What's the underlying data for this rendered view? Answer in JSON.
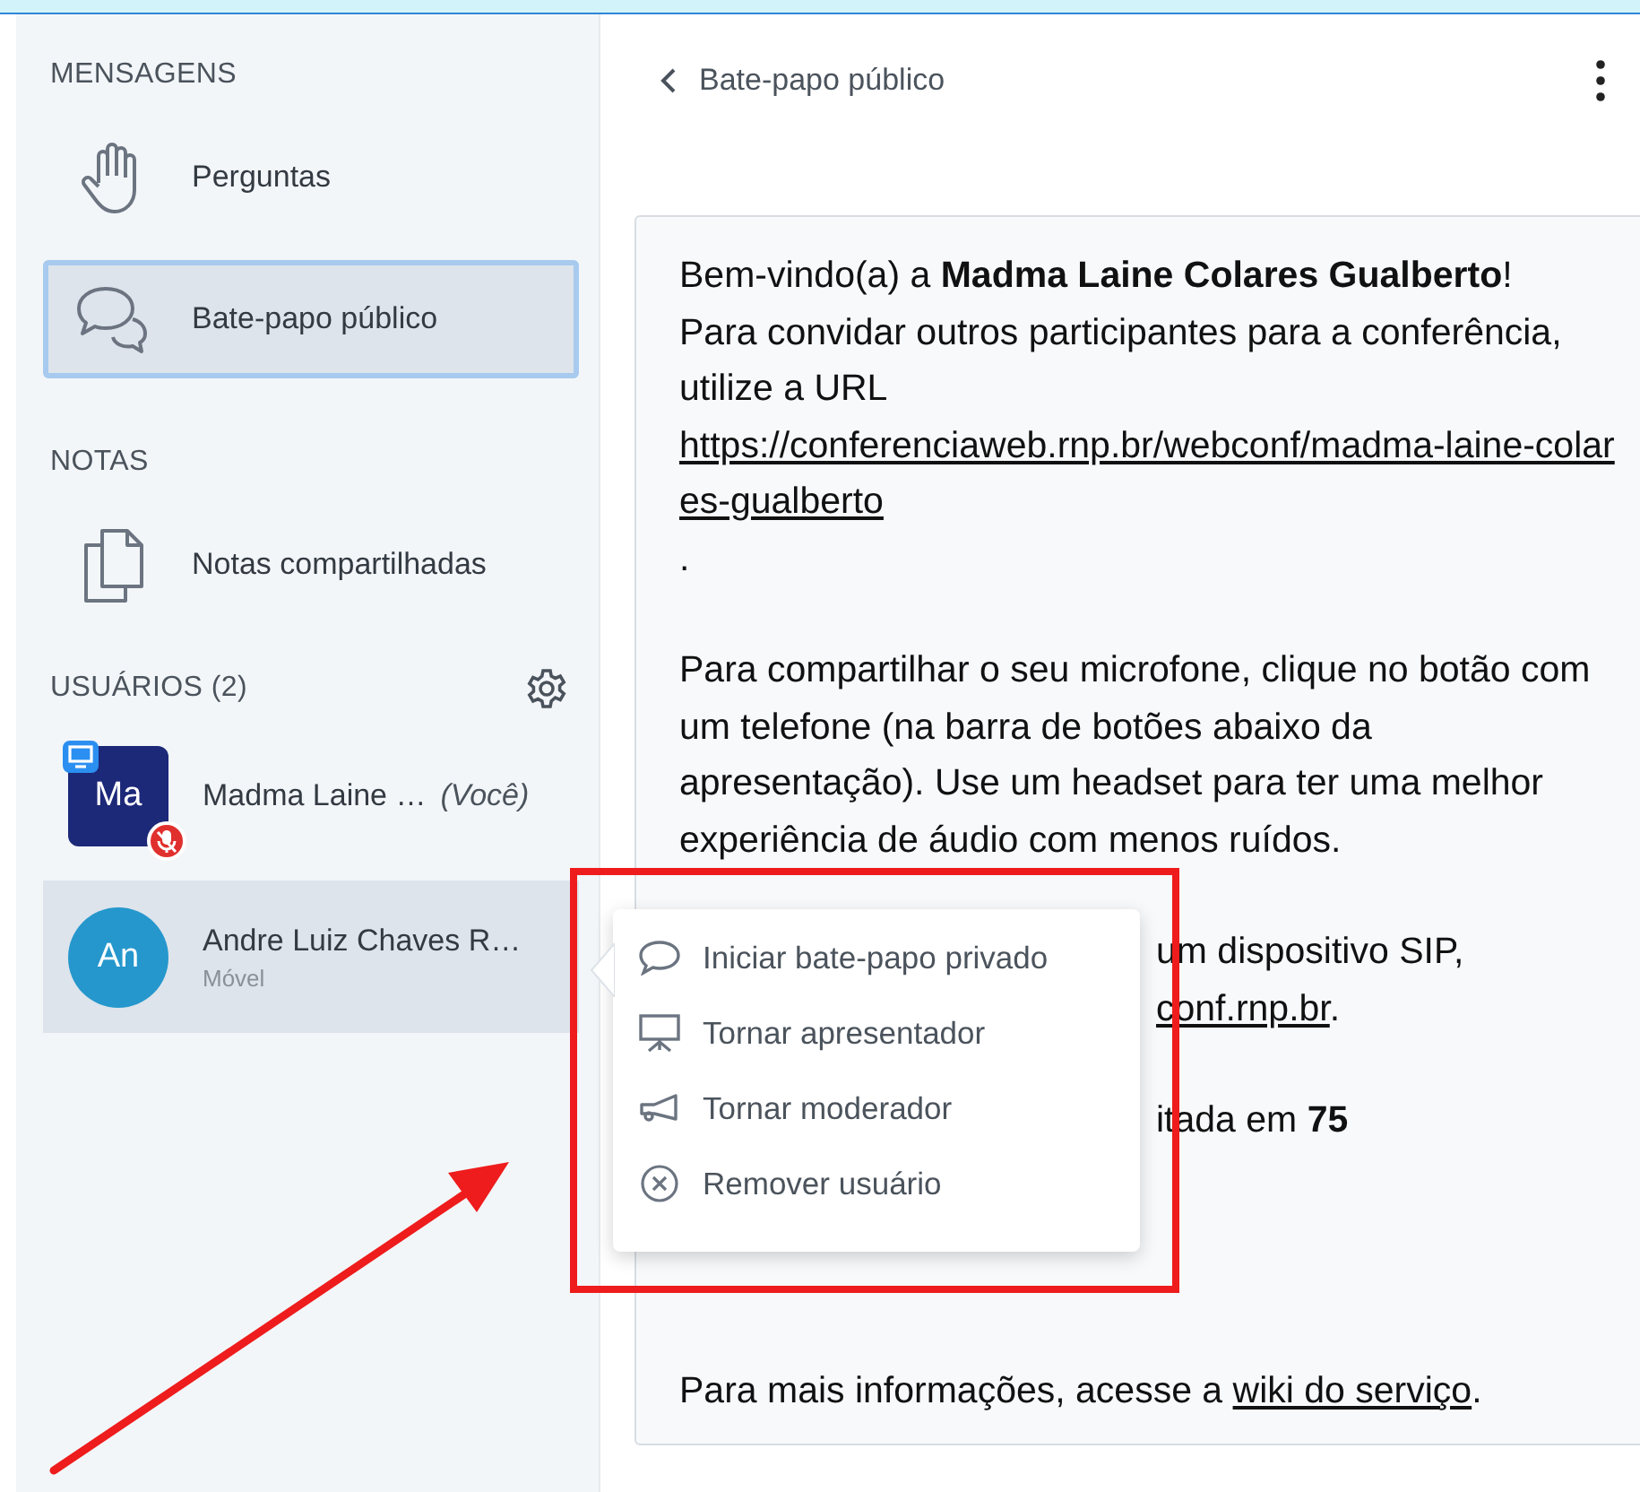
{
  "sidebar": {
    "sections": [
      {
        "title": "MENSAGENS",
        "items": [
          {
            "label": "Perguntas",
            "selected": false
          },
          {
            "label": "Bate-papo público",
            "selected": true
          }
        ]
      },
      {
        "title": "NOTAS",
        "items": [
          {
            "label": "Notas compartilhadas",
            "selected": false
          }
        ]
      }
    ],
    "users": {
      "title": "USUÁRIOS (2)",
      "list": [
        {
          "initials": "Ma",
          "name": "Madma Laine …",
          "tag": "(Você)",
          "color": "#1c2878",
          "presenter": true,
          "mic_muted": true,
          "selected": false
        },
        {
          "initials": "An",
          "name": "Andre Luiz Chaves R…",
          "status": "Móvel",
          "color": "#2597cc",
          "presenter": false,
          "mic_muted": false,
          "selected": true
        }
      ]
    }
  },
  "chat": {
    "title": "Bate-papo público",
    "message": [
      {
        "kind": "paragraph",
        "parts": [
          {
            "kind": "text",
            "text": "Bem-vindo(a) a **Madma Laine Colares Gualberto**!\nPara convidar outros participantes para a conferência, utilize a URL "
          },
          {
            "kind": "link",
            "text": "https://conferenciaweb.rnp.br/webconf/madma-laine-colares-gualberto"
          },
          {
            "kind": "text",
            "text": "."
          }
        ]
      },
      {
        "kind": "paragraph",
        "parts": [
          {
            "kind": "text",
            "text": "Para compartilhar o seu microfone, clique no botão com um telefone (na barra de botões abaixo da apresentação). Use um headset para ter uma melhor experiência de áudio com menos ruídos."
          }
        ]
      },
      {
        "kind": "fragment",
        "parts": [
          {
            "kind": "text",
            "text": "um dispositivo SIP,"
          }
        ]
      },
      {
        "kind": "fragment",
        "parts": [
          {
            "kind": "link",
            "text": "conf.rnp.br"
          },
          {
            "kind": "text",
            "text": "."
          }
        ]
      },
      {
        "kind": "fragment",
        "parts": [
          {
            "kind": "text",
            "text": "itada em **75**"
          }
        ]
      },
      {
        "kind": "paragraph",
        "parts": [
          {
            "kind": "text",
            "text": "Para mais informações, acesse a "
          },
          {
            "kind": "link",
            "text": "wiki do serviço"
          },
          {
            "kind": "text",
            "text": "."
          }
        ]
      }
    ]
  },
  "user_menu": {
    "items": [
      {
        "label": "Iniciar bate-papo privado"
      },
      {
        "label": "Tornar apresentador"
      },
      {
        "label": "Tornar moderador"
      },
      {
        "label": "Remover usuário"
      }
    ]
  }
}
